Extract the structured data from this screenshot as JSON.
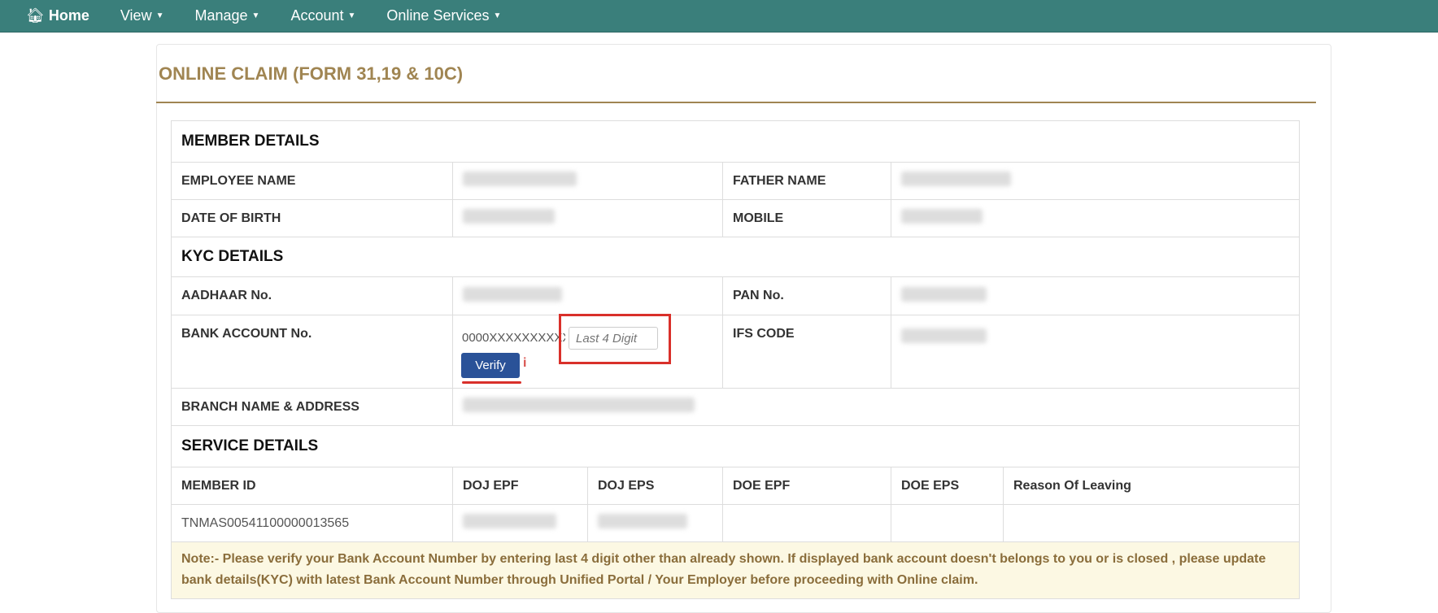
{
  "nav": {
    "items": [
      {
        "label": "Home",
        "icon": "home-icon"
      },
      {
        "label": "View"
      },
      {
        "label": "Manage"
      },
      {
        "label": "Account"
      },
      {
        "label": "Online Services"
      }
    ]
  },
  "page_title": "ONLINE CLAIM (FORM 31,19 & 10C)",
  "member": {
    "heading": "MEMBER DETAILS",
    "employee_name": "EMPLOYEE NAME",
    "father_name": "FATHER NAME",
    "dob": "DATE OF BIRTH",
    "mobile": "MOBILE"
  },
  "kyc": {
    "heading": "KYC DETAILS",
    "aadhaar": "AADHAAR No.",
    "pan": "PAN No.",
    "bank": "BANK ACCOUNT No.",
    "bank_value": "0000XXXXXXXXXX",
    "last4_placeholder": "Last 4 Digit",
    "verify": "Verify",
    "info": "i",
    "ifs": "IFS CODE",
    "branch": "BRANCH NAME & ADDRESS"
  },
  "service": {
    "heading": "SERVICE DETAILS",
    "columns": [
      "MEMBER ID",
      "DOJ EPF",
      "DOJ EPS",
      "DOE EPF",
      "DOE EPS",
      "Reason Of Leaving"
    ],
    "member_id": "TNMAS00541100000013565"
  },
  "note": "Note:- Please verify your Bank Account Number by entering last 4 digit other than already shown. If displayed bank account doesn't belongs to you or is closed , please update bank details(KYC) with latest Bank Account Number through Unified Portal / Your Employer before proceeding with Online claim."
}
